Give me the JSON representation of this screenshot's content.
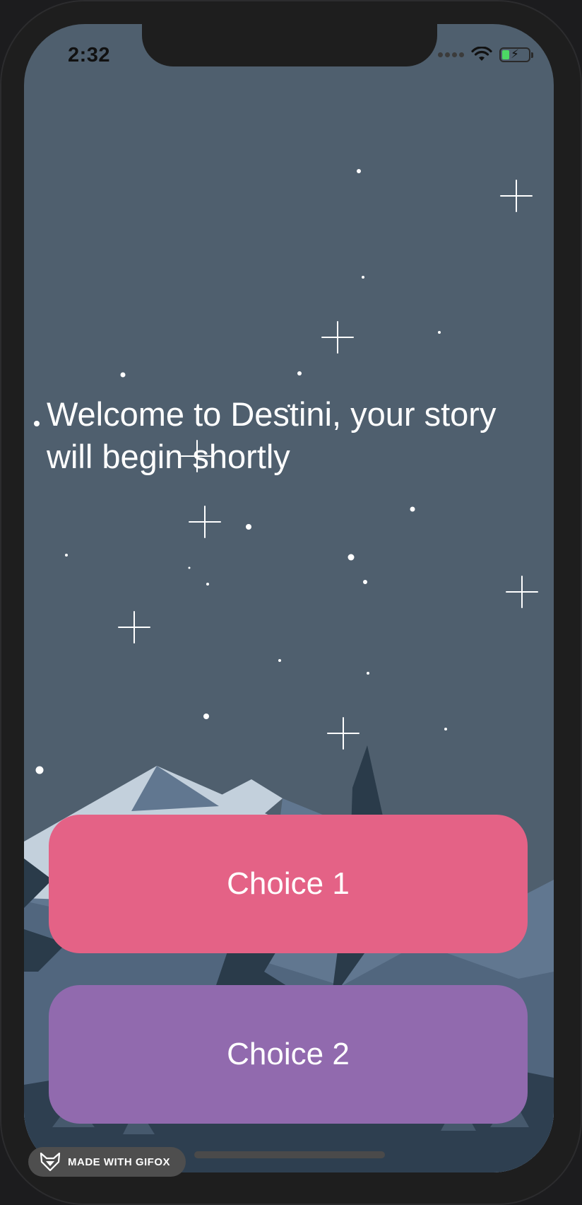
{
  "status_bar": {
    "time": "2:32"
  },
  "story": {
    "text": "Welcome to Destini, your story will begin shortly"
  },
  "choices": {
    "choice_1": "Choice 1",
    "choice_2": "Choice 2"
  },
  "watermark": {
    "label": "MADE WITH GIFOX"
  },
  "colors": {
    "sky": "#4f5f6e",
    "choice_1": "#e46286",
    "choice_2": "#916aae",
    "text": "#ffffff"
  }
}
